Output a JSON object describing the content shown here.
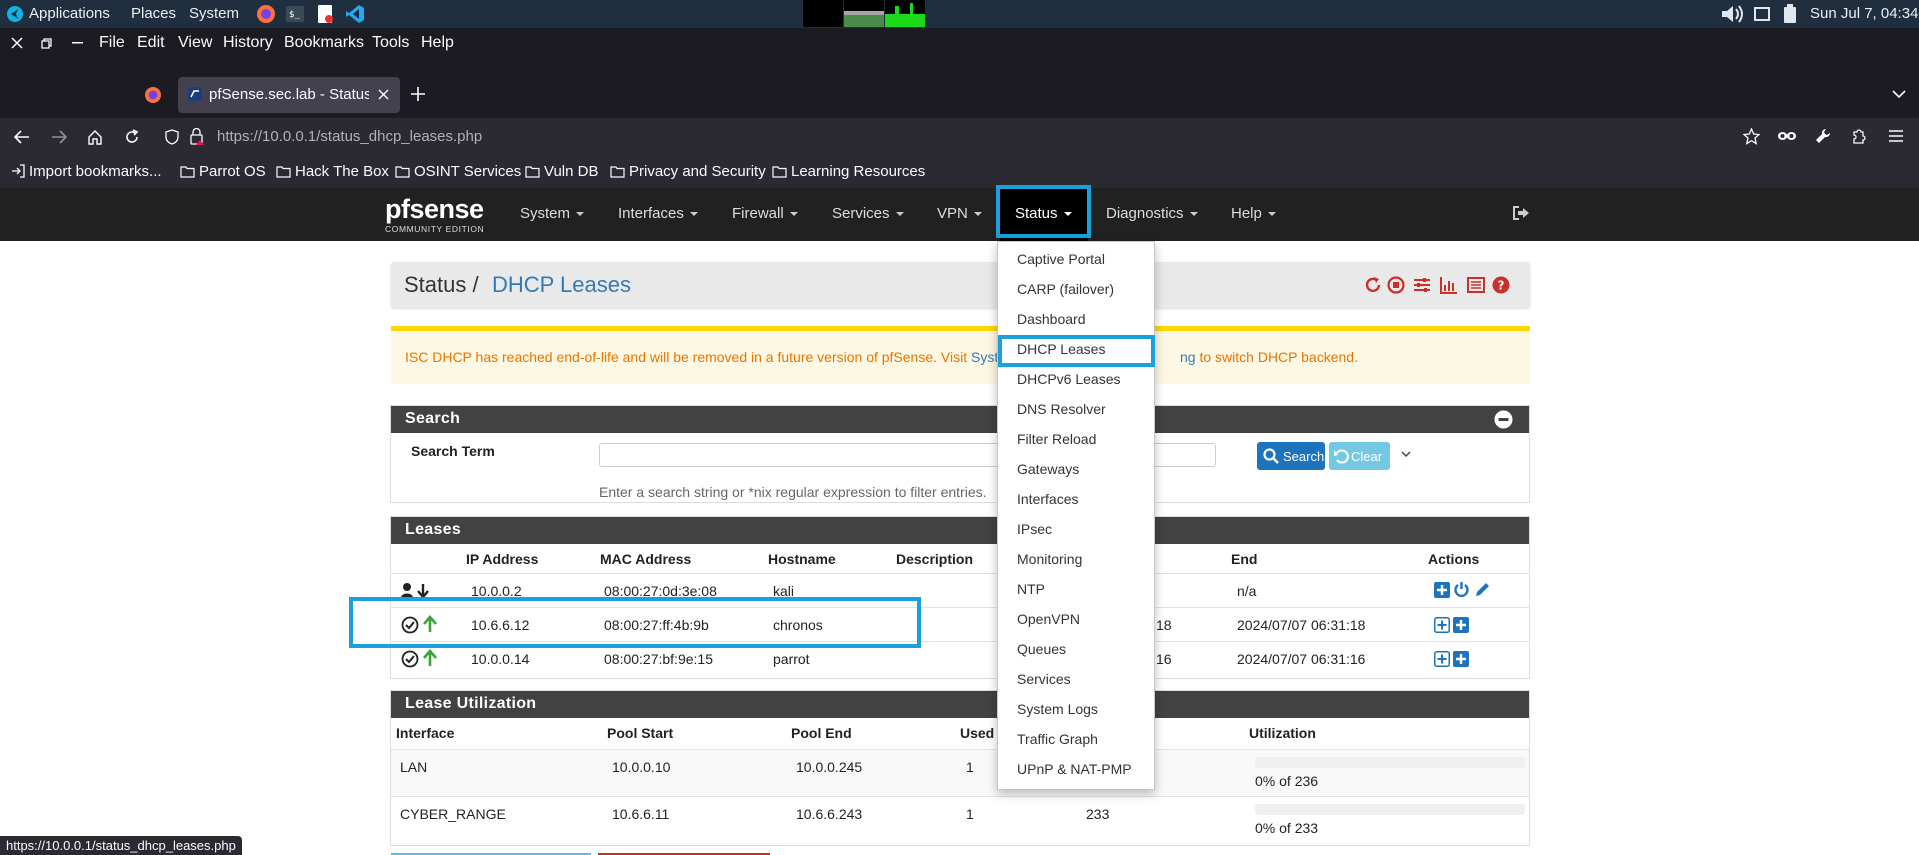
{
  "desktop_panel": {
    "applications": "Applications",
    "places": "Places",
    "system": "System",
    "clock": "Sun Jul 7, 04:34"
  },
  "browser": {
    "menu": [
      "File",
      "Edit",
      "View",
      "History",
      "Bookmarks",
      "Tools",
      "Help"
    ],
    "tab_title": "pfSense.sec.lab - Status: D",
    "url_host": "https://10.0.0.1",
    "url_path": "/status_dhcp_leases.php",
    "bookmarks": [
      "Import bookmarks...",
      "Parrot OS",
      "Hack The Box",
      "OSINT Services",
      "Vuln DB",
      "Privacy and Security",
      "Learning Resources"
    ],
    "status_url": "https://10.0.0.1/status_dhcp_leases.php"
  },
  "pfsense": {
    "logo": "pfsense",
    "logo_sub": "COMMUNITY EDITION",
    "nav": [
      "System",
      "Interfaces",
      "Firewall",
      "Services",
      "VPN",
      "Status",
      "Diagnostics",
      "Help"
    ],
    "breadcrumb_root": "Status /",
    "breadcrumb_page": "DHCP Leases",
    "warning_pre": "ISC DHCP has reached end-of-life and will be removed in a future version of pfSense. Visit ",
    "warning_link1": "Syste",
    "warning_link2": "ng",
    "warning_post": " to switch DHCP backend.",
    "search_panel": {
      "title": "Search",
      "label": "Search Term",
      "hint": "Enter a search string or *nix regular expression to filter entries.",
      "search_button": "Search",
      "clear_button": "Clear"
    },
    "leases_panel": {
      "title": "Leases",
      "headers": [
        "IP Address",
        "MAC Address",
        "Hostname",
        "Description",
        "End",
        "Actions"
      ],
      "rows": [
        {
          "ip": "10.0.0.2",
          "mac": "08:00:27:0d:3e:08",
          "hostname": "kali",
          "start_tail": "",
          "end": "n/a"
        },
        {
          "ip": "10.6.6.12",
          "mac": "08:00:27:ff:4b:9b",
          "hostname": "chronos",
          "start_tail": "18",
          "end": "2024/07/07 06:31:18"
        },
        {
          "ip": "10.0.0.14",
          "mac": "08:00:27:bf:9e:15",
          "hostname": "parrot",
          "start_tail": "16",
          "end": "2024/07/07 06:31:16"
        }
      ]
    },
    "util_panel": {
      "title": "Lease Utilization",
      "headers": [
        "Interface",
        "Pool Start",
        "Pool End",
        "Used",
        "Utilization"
      ],
      "rows": [
        {
          "iface": "LAN",
          "start": "10.0.0.10",
          "end": "10.0.0.245",
          "used": "1",
          "capacity": "",
          "util": "0% of 236"
        },
        {
          "iface": "CYBER_RANGE",
          "start": "10.6.6.11",
          "end": "10.6.6.243",
          "used": "1",
          "capacity": "233",
          "util": "0% of 233"
        }
      ]
    },
    "status_menu": [
      "Captive Portal",
      "CARP (failover)",
      "Dashboard",
      "DHCP Leases",
      "DHCPv6 Leases",
      "DNS Resolver",
      "Filter Reload",
      "Gateways",
      "Interfaces",
      "IPsec",
      "Monitoring",
      "NTP",
      "OpenVPN",
      "Queues",
      "Services",
      "System Logs",
      "Traffic Graph",
      "UPnP & NAT-PMP"
    ]
  },
  "colors": {
    "highlight": "#1aa0dc",
    "pf_red": "#c9302c",
    "pf_blue": "#337ab7",
    "warning_bg": "#fcf8e3",
    "warning_text": "#f0880a"
  }
}
